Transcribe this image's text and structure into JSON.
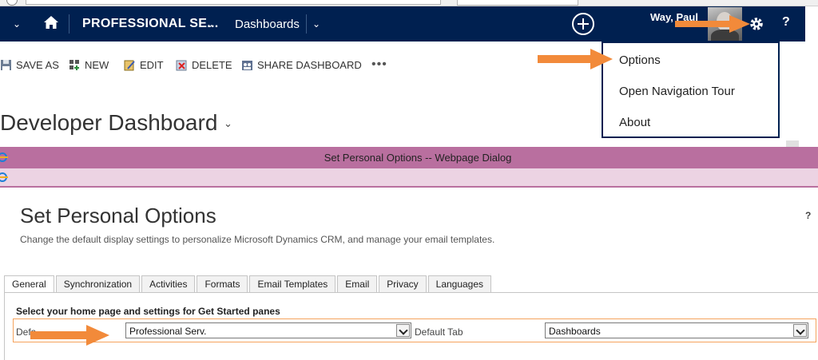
{
  "navbar": {
    "area_label": "PROFESSIONAL SE...",
    "subarea_label": "Dashboards",
    "user_name": "Way, Paul",
    "help_label": "?"
  },
  "commands": {
    "save_as": "SAVE AS",
    "new": "NEW",
    "edit": "EDIT",
    "delete": "DELETE",
    "share_dashboard": "SHARE DASHBOARD",
    "more": "•••"
  },
  "dashboard": {
    "title": "Developer Dashboard"
  },
  "settings_menu": {
    "items": [
      "Options",
      "Open Navigation Tour",
      "About"
    ]
  },
  "dialog": {
    "window_title": "Set Personal Options -- Webpage Dialog",
    "heading": "Set Personal Options",
    "help_label": "?",
    "description": "Change the default display settings to personalize Microsoft Dynamics CRM, and manage your email templates.",
    "tabs": [
      "General",
      "Synchronization",
      "Activities",
      "Formats",
      "Email Templates",
      "Email",
      "Privacy",
      "Languages"
    ],
    "active_tab": "General",
    "section_title": "Select your home page and settings for Get Started panes",
    "default_pane_label": "Defa",
    "default_pane_value": "Professional Serv.",
    "default_tab_label": "Default Tab",
    "default_tab_value": "Dashboards"
  },
  "colors": {
    "nav_bg": "#002050",
    "dialog_title_bg": "#b96f9f",
    "dialog_bar_bg": "#ecd3e3",
    "callout_arrow": "#f28a3a"
  }
}
